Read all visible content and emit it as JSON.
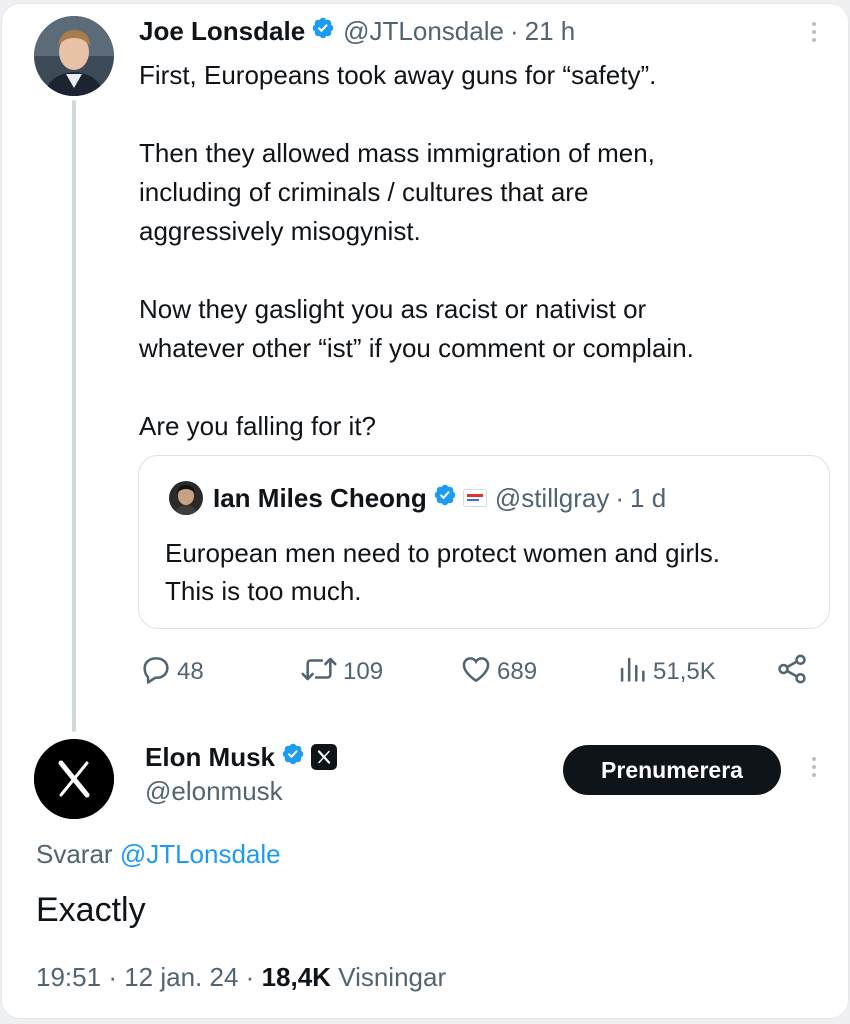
{
  "quoted_parent": {
    "author_name": "Joe Lonsdale",
    "author_handle": "@JTLonsdale",
    "time": "21 h",
    "paragraphs": [
      "First, Europeans took away guns for “safety”.",
      "Then they allowed mass immigration of men,\nincluding of criminals / cultures that are\naggressively misogynist.",
      "Now they gaslight you as racist or nativist or\nwhatever other “ist” if you comment or complain.",
      "Are you falling for it?"
    ],
    "quote": {
      "author_name": "Ian Miles Cheong",
      "author_handle": "@stillgray",
      "time": "1 d",
      "text": "European men need to protect women and girls.\nThis is too much."
    },
    "actions": {
      "replies": "48",
      "reposts": "109",
      "likes": "689",
      "views": "51,5K"
    }
  },
  "reply": {
    "author_name": "Elon Musk",
    "author_handle": "@elonmusk",
    "subscribe_label": "Prenumerera",
    "replying_prefix": "Svarar",
    "replying_to": "@JTLonsdale",
    "text": "Exactly",
    "time": "19:51",
    "date": "12 jan. 24",
    "views_count": "18,4K",
    "views_label": "Visningar"
  },
  "separator": "·",
  "colors": {
    "text": "#0f1419",
    "secondary": "#536471",
    "link": "#1d9bf0",
    "verified": "#1d9bf0",
    "button_bg": "#0f1419"
  }
}
